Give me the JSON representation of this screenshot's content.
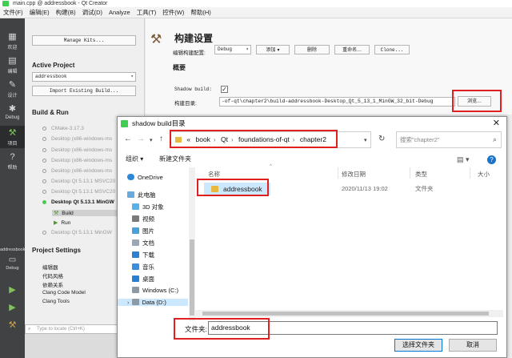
{
  "window": {
    "title": "main.cpp @ addressbook - Qt Creator"
  },
  "menu": [
    "文件(F)",
    "编辑(E)",
    "构建(B)",
    "调试(D)",
    "Analyze",
    "工具(T)",
    "控件(W)",
    "帮助(H)"
  ],
  "modes": [
    {
      "label": "欢迎",
      "icon": "grid-icon"
    },
    {
      "label": "编辑",
      "icon": "edit-icon"
    },
    {
      "label": "设计",
      "icon": "pencil-icon"
    },
    {
      "label": "Debug",
      "icon": "bug-icon"
    },
    {
      "label": "项目",
      "icon": "wrench-icon"
    },
    {
      "label": "帮助",
      "icon": "help-icon"
    }
  ],
  "target": {
    "label": "addressbook",
    "subtitle": "Debug"
  },
  "side": {
    "manage_kits": "Manage Kits...",
    "active_project_heading": "Active Project",
    "project_name": "addressbook",
    "import_build": "Import Existing Build...",
    "build_run_heading": "Build & Run",
    "kits": [
      "CMake-3.17.3",
      "Desktop (x86-windows-ms",
      "Desktop (x86-windows-ms",
      "Desktop (x86-windows-ms",
      "Desktop (x86-windows-ms",
      "Desktop Qt 5.13.1 MSVC20",
      "Desktop Qt 5.13.1 MSVC20",
      "Desktop Qt 5.13.1 MinGW",
      "Desktop Qt 5.13.1 MinGW"
    ],
    "build_label": "Build",
    "run_label": "Run",
    "project_settings_heading": "Project Settings",
    "settings_items": [
      "编辑器",
      "代码风格",
      "依赖关系",
      "Clang Code Model",
      "Clang Tools"
    ],
    "locator_placeholder": "Type to locate (Ctrl+K)"
  },
  "main": {
    "title": "构建设置",
    "config_label": "编辑构建配置:",
    "config_value": "Debug",
    "add_button": "添加",
    "delete_button": "删除",
    "rename_button": "重命名...",
    "clone_button": "Clone...",
    "overview_heading": "概要",
    "shadow_build_label": "Shadow build:",
    "build_dir_label": "构建目录:",
    "build_dir_value": "-of-qt\\chapter2\\build-addressbook-Desktop_Qt_5_13_1_MinGW_32_bit-Debug",
    "browse_button": "浏览..."
  },
  "dialog": {
    "title": "shadow build目录",
    "path": [
      "«",
      "book",
      "Qt",
      "foundations-of-qt",
      "chapter2"
    ],
    "search_placeholder": "搜索\"chapter2\"",
    "organize": "组织 ▾",
    "new_folder": "新建文件夹",
    "nav": [
      "OneDrive",
      "此电脑",
      "3D 对象",
      "视频",
      "图片",
      "文档",
      "下载",
      "音乐",
      "桌面",
      "Windows (C:)",
      "Data (D:)"
    ],
    "columns": {
      "name": "名称",
      "date": "修改日期",
      "type": "类型",
      "size": "大小"
    },
    "rows": [
      {
        "name": "addressbook",
        "date": "2020/11/13 19:02",
        "type": "文件夹"
      }
    ],
    "filename_label": "文件夹:",
    "filename_value": "addressbook",
    "select_button": "选择文件夹",
    "cancel_button": "取消"
  },
  "colors": {
    "accent": "#41cd52",
    "highlight": "#cce8ff",
    "annotation": "#e02020",
    "modebar": "#404244"
  }
}
